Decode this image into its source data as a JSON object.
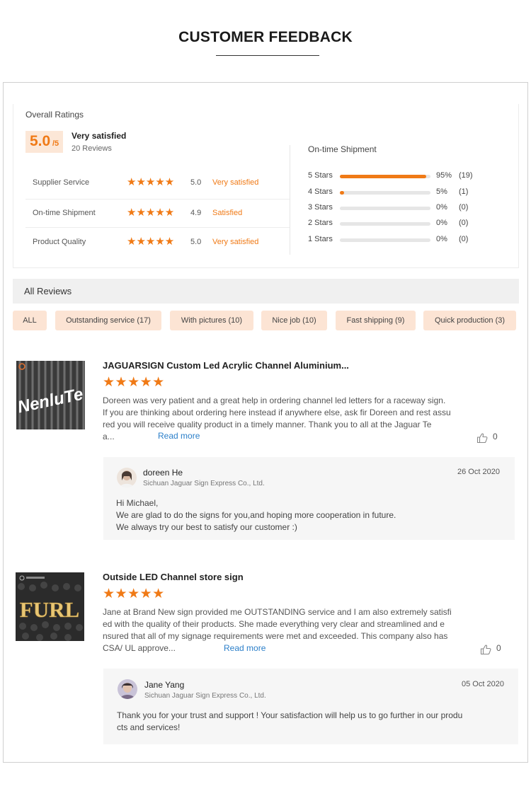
{
  "page": {
    "title": "CUSTOMER FEEDBACK"
  },
  "overall": {
    "label": "Overall Ratings",
    "score": "5.0",
    "score_suffix": "/5",
    "word": "Very satisfied",
    "reviews": "20 Reviews"
  },
  "categories": [
    {
      "name": "Supplier Service",
      "stars": "★★★★★",
      "score": "5.0",
      "word": "Very satisfied",
      "rating": 5.0
    },
    {
      "name": "On-time Shipment",
      "stars": "★★★★★",
      "score": "4.9",
      "word": "Satisfied",
      "rating": 4.9
    },
    {
      "name": "Product Quality",
      "stars": "★★★★★",
      "score": "5.0",
      "word": "Very satisfied",
      "rating": 5.0
    }
  ],
  "shipment": {
    "title": "On-time Shipment",
    "rows": [
      {
        "label": "5 Stars",
        "pct": "95%",
        "count": "(19)",
        "fraction": 0.95
      },
      {
        "label": "4 Stars",
        "pct": "5%",
        "count": "(1)",
        "fraction": 0.05
      },
      {
        "label": "3 Stars",
        "pct": "0%",
        "count": "(0)",
        "fraction": 0
      },
      {
        "label": "2 Stars",
        "pct": "0%",
        "count": "(0)",
        "fraction": 0
      },
      {
        "label": "1 Stars",
        "pct": "0%",
        "count": "(0)",
        "fraction": 0
      }
    ]
  },
  "all_reviews": {
    "title": "All Reviews",
    "filters": [
      "ALL",
      "Outstanding service (17)",
      "With pictures (10)",
      "Nice job (10)",
      "Fast shipping (9)",
      "Quick production (3)"
    ]
  },
  "reviews": [
    {
      "title": "JAGUARSIGN Custom Led Acrylic Channel Aluminium...",
      "stars": "★★★★★",
      "rating": 5,
      "thumb_text": "NenluTe",
      "body": [
        "Doreen was very patient and a great help in ordering channel led letters for a raceway sign.",
        "If you are thinking about ordering here instead if anywhere else, ask fir Doreen and rest assu",
        "red you will receive quality product in a timely manner.  Thank you to all at the Jaguar Te",
        "a..."
      ],
      "read_more": "Read more",
      "likes": "0",
      "reply": {
        "name": "doreen He",
        "company": "Sichuan Jaguar Sign Express Co., Ltd.",
        "date": "26 Oct 2020",
        "text": [
          "Hi Michael,",
          "We are glad to do the signs for you,and hoping more cooperation in future.",
          "We always try our best to satisfy our customer :)"
        ]
      }
    },
    {
      "title": "Outside LED Channel store sign",
      "stars": "★★★★★",
      "rating": 5,
      "thumb_text": "FURL",
      "body": [
        "Jane at Brand New sign provided me OUTSTANDING service and I am also extremely satisfi",
        "ed with the quality of their products. She made everything very clear and streamlined and e",
        "nsured that all of my signage requirements were met and exceeded. This company also has",
        "CSA/ UL approve..."
      ],
      "read_more": "Read more",
      "likes": "0",
      "reply": {
        "name": "Jane Yang",
        "company": "Sichuan Jaguar Sign Express Co., Ltd.",
        "date": "05 Oct 2020",
        "text": [
          "Thank you for your trust and support !  Your satisfaction will help us to go further in our produ",
          "cts and services!"
        ]
      }
    }
  ]
}
